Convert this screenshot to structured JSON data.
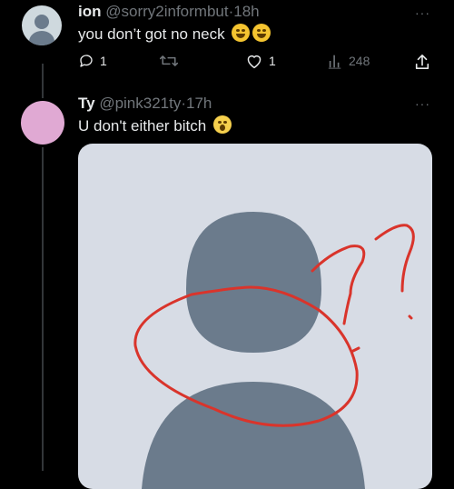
{
  "tweets": [
    {
      "display_name": "ion",
      "handle": "@sorry2informbut",
      "separator": "·",
      "time": "18h",
      "text": "you don’t got no neck",
      "emoji": [
        "rolling-on-floor-laughing",
        "rolling-on-floor-laughing"
      ],
      "more_label": "···",
      "actions": {
        "reply_count": "1",
        "retweet_count": "",
        "like_count": "1",
        "view_count": "248"
      }
    },
    {
      "display_name": "Ty",
      "handle": "@pink321ty",
      "separator": "·",
      "time": "17h",
      "text": "U don't either bitch",
      "emoji": [
        "face-screaming-in-fear"
      ],
      "more_label": "···",
      "media": {
        "description_icon": "default-profile-silhouette-with-red-scribbles"
      }
    }
  ],
  "colors": {
    "background": "#000000",
    "text": "#e7e9ea",
    "muted": "#71767b",
    "avatar_default": "#cfd9de",
    "avatar_pink": "#e0a9d3",
    "silhouette": "#6b7b8c",
    "media_bg": "#d7dce5",
    "scribble": "#d9342b"
  }
}
